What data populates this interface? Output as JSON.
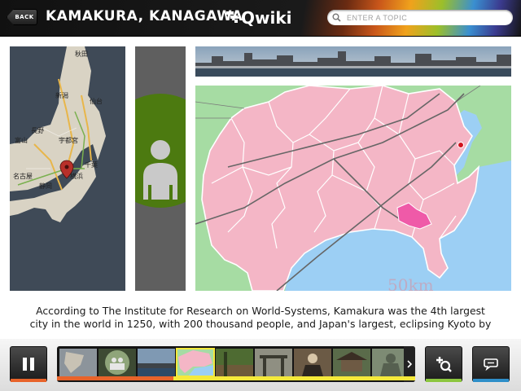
{
  "header": {
    "back_label": "BACK",
    "title": "KAMAKURA, KANAGAWA",
    "logo_text": "Qwiki",
    "search_placeholder": "ENTER A TOPIC"
  },
  "map_labels": {
    "akita": "秋田",
    "niigata": "新潟",
    "sendai": "仙台",
    "nagano": "長野",
    "toyama": "富山",
    "utsunomiya": "宇都宮",
    "chiba": "千葉",
    "nagoya": "名古屋",
    "yokohama": "横浜",
    "shizuoka": "静岡"
  },
  "scale_label": "50km",
  "caption": {
    "line1": "According to The Institute for Research on World-Systems, Kamakura was the 4th largest",
    "line2": "city in the world in 1250, with 200 thousand people, and Japan's largest, eclipsing Kyoto by"
  },
  "controls": {
    "pause_icon": "pause-icon",
    "add_icon": "add-qwiki-icon",
    "comment_icon": "comment-icon"
  },
  "colors": {
    "accent_orange": "#e8632a",
    "accent_green": "#8cc63f",
    "accent_blue": "#2f8fc9",
    "accent_yellow": "#f5e93a",
    "map_pink": "#f4b6c6",
    "map_sea": "#9ccff4",
    "map_land": "#a6dca3",
    "kamakura_highlight": "#ef5aa8"
  }
}
